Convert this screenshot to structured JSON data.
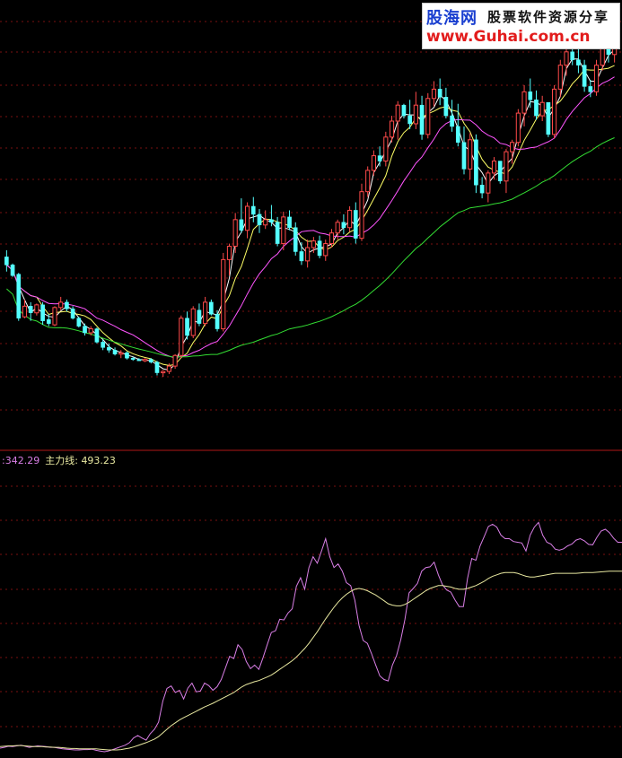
{
  "watermark": {
    "brand": "股海网",
    "slogan": "股票软件资源分享",
    "url": "www.Guhai.com.cn"
  },
  "indicator_panel": {
    "prefix": ":",
    "value1": "342.29",
    "name2": "主力线:",
    "value2": "493.23"
  },
  "colors": {
    "background": "#000000",
    "grid": "#7a1010",
    "separator": "#b01818",
    "up_candle": "#ff4a4a",
    "down_candle": "#54ffff",
    "ma_short": "#ffffff",
    "ma_mid": "#ffff66",
    "ma_long1": "#ff55ff",
    "ma_long2": "#33dd33",
    "ind_line1": "#d97fe6",
    "ind_line2": "#e8e8a0"
  },
  "chart_data": [
    {
      "type": "candlestick",
      "ylim": [
        0,
        100
      ],
      "ma_lines": [
        "white",
        "yellow",
        "magenta",
        "green"
      ],
      "candles": [
        [
          92,
          97,
          81,
          86
        ],
        [
          86,
          87,
          77,
          78
        ],
        [
          79,
          80,
          44,
          46
        ],
        [
          47,
          60,
          46,
          55
        ],
        [
          55,
          58,
          44,
          50
        ],
        [
          50,
          57,
          48,
          56
        ],
        [
          56,
          58,
          41,
          44
        ],
        [
          45,
          49,
          40,
          42
        ],
        [
          41,
          55,
          40,
          54
        ],
        [
          54,
          62,
          52,
          58
        ],
        [
          58,
          60,
          51,
          53
        ],
        [
          53,
          55,
          45,
          46
        ],
        [
          46,
          47,
          39,
          40
        ],
        [
          40,
          42,
          33,
          35
        ],
        [
          35,
          40,
          33,
          38
        ],
        [
          38,
          39,
          27,
          28
        ],
        [
          28,
          30,
          22,
          24
        ],
        [
          24,
          27,
          20,
          22
        ],
        [
          22,
          24,
          18,
          19
        ],
        [
          19,
          22,
          16,
          20
        ],
        [
          20,
          21,
          15,
          16
        ],
        [
          16,
          17,
          14,
          15
        ],
        [
          15,
          16,
          14,
          14
        ],
        [
          14,
          16,
          13,
          15
        ],
        [
          15,
          16,
          12,
          13
        ],
        [
          13,
          14,
          3,
          5
        ],
        [
          5,
          7,
          2,
          6
        ],
        [
          6,
          12,
          4,
          10
        ],
        [
          10,
          19,
          8,
          18
        ],
        [
          18,
          48,
          16,
          46
        ],
        [
          46,
          51,
          30,
          33
        ],
        [
          33,
          55,
          31,
          53
        ],
        [
          52,
          57,
          40,
          42
        ],
        [
          42,
          62,
          40,
          58
        ],
        [
          58,
          60,
          48,
          49
        ],
        [
          49,
          52,
          36,
          38
        ],
        [
          38,
          95,
          36,
          90
        ],
        [
          90,
          102,
          78,
          100
        ],
        [
          100,
          125,
          95,
          120
        ],
        [
          120,
          136,
          110,
          112
        ],
        [
          112,
          133,
          106,
          130
        ],
        [
          130,
          137,
          118,
          124
        ],
        [
          124,
          128,
          110,
          116
        ],
        [
          116,
          127,
          113,
          120
        ],
        [
          120,
          131,
          115,
          118
        ],
        [
          118,
          122,
          100,
          102
        ],
        [
          102,
          126,
          97,
          122
        ],
        [
          122,
          127,
          112,
          114
        ],
        [
          114,
          118,
          93,
          96
        ],
        [
          96,
          103,
          86,
          89
        ],
        [
          89,
          105,
          84,
          99
        ],
        [
          99,
          107,
          95,
          104
        ],
        [
          104,
          108,
          91,
          93
        ],
        [
          93,
          105,
          89,
          102
        ],
        [
          102,
          113,
          99,
          110
        ],
        [
          110,
          120,
          105,
          118
        ],
        [
          118,
          124,
          109,
          114
        ],
        [
          114,
          130,
          111,
          127
        ],
        [
          127,
          133,
          102,
          106
        ],
        [
          106,
          147,
          104,
          141
        ],
        [
          141,
          160,
          137,
          157
        ],
        [
          157,
          172,
          153,
          168
        ],
        [
          168,
          175,
          160,
          164
        ],
        [
          164,
          186,
          160,
          182
        ],
        [
          182,
          198,
          178,
          194
        ],
        [
          194,
          209,
          180,
          206
        ],
        [
          206,
          207,
          196,
          198
        ],
        [
          198,
          210,
          188,
          192
        ],
        [
          192,
          216,
          188,
          206
        ],
        [
          206,
          213,
          180,
          184
        ],
        [
          184,
          215,
          181,
          211
        ],
        [
          211,
          224,
          205,
          218
        ],
        [
          218,
          226,
          206,
          212
        ],
        [
          212,
          219,
          196,
          198
        ],
        [
          198,
          210,
          186,
          190
        ],
        [
          190,
          207,
          175,
          178
        ],
        [
          178,
          190,
          154,
          158
        ],
        [
          158,
          185,
          150,
          180
        ],
        [
          180,
          184,
          140,
          146
        ],
        [
          146,
          152,
          136,
          140
        ],
        [
          140,
          157,
          133,
          155
        ],
        [
          155,
          167,
          150,
          164
        ],
        [
          164,
          162,
          147,
          149
        ],
        [
          149,
          173,
          140,
          171
        ],
        [
          171,
          180,
          162,
          178
        ],
        [
          178,
          203,
          175,
          200
        ],
        [
          200,
          221,
          190,
          216
        ],
        [
          216,
          226,
          204,
          210
        ],
        [
          210,
          217,
          195,
          198
        ],
        [
          198,
          213,
          194,
          208
        ],
        [
          208,
          203,
          182,
          184
        ],
        [
          184,
          221,
          181,
          218
        ],
        [
          218,
          240,
          212,
          236
        ],
        [
          236,
          253,
          228,
          246
        ],
        [
          246,
          254,
          236,
          240
        ],
        [
          240,
          252,
          230,
          236
        ],
        [
          236,
          240,
          216,
          220
        ],
        [
          220,
          225,
          212,
          216
        ],
        [
          216,
          240,
          213,
          236
        ],
        [
          236,
          254,
          232,
          250
        ],
        [
          250,
          258,
          238,
          244
        ],
        [
          244,
          252,
          238,
          249
        ]
      ]
    },
    {
      "type": "line",
      "name": "主力线",
      "ylim": [
        0,
        800
      ],
      "series": [
        {
          "values": [
            20,
            22,
            25,
            24,
            26,
            28,
            25,
            22,
            24,
            26,
            25,
            24,
            22,
            22,
            20,
            18,
            17,
            16,
            15,
            15,
            16,
            16,
            17,
            14,
            12,
            10,
            12,
            16,
            20,
            24,
            28,
            35,
            48,
            55,
            48,
            42,
            60,
            72,
            92,
            150,
            185,
            192,
            174,
            180,
            156,
            186,
            200,
            176,
            178,
            200,
            193,
            180,
            190,
            210,
            242,
            274,
            268,
            306,
            293,
            260,
            240,
            250,
            238,
            270,
            306,
            340,
            345,
            377,
            375,
            394,
            406,
            468,
            492,
            460,
            520,
            550,
            532,
            565,
            600,
            550,
            520,
            530,
            510,
            478,
            470,
            430,
            360,
            318,
            310,
            282,
            250,
            220,
            210,
            206,
            250,
            276,
            320,
            376,
            450,
            462,
            476,
            510,
            520,
            522,
            535,
            500,
            472,
            458,
            452,
            430,
            412,
            412,
            490,
            545,
            540,
            580,
            606,
            634,
            640,
            632,
            610,
            600,
            600,
            592,
            590,
            588,
            566,
            610,
            632,
            645,
            610,
            590,
            585,
            571,
            568,
            572,
            580,
            585,
            596,
            600,
            594,
            584,
            583,
            604,
            621,
            626,
            617,
            601,
            590,
            590
          ]
        },
        {
          "values": [
            24,
            25,
            26,
            26,
            27,
            27,
            26,
            25,
            24,
            24,
            24,
            23,
            23,
            22,
            22,
            21,
            20,
            19,
            19,
            18,
            18,
            18,
            18,
            18,
            17,
            16,
            15,
            15,
            15,
            16,
            18,
            20,
            23,
            27,
            31,
            35,
            40,
            45,
            52,
            62,
            72,
            82,
            90,
            98,
            104,
            110,
            116,
            122,
            128,
            134,
            139,
            144,
            150,
            156,
            162,
            168,
            174,
            182,
            190,
            196,
            200,
            204,
            207,
            212,
            217,
            222,
            230,
            238,
            246,
            254,
            262,
            272,
            284,
            296,
            310,
            326,
            342,
            360,
            378,
            394,
            410,
            424,
            436,
            446,
            454,
            460,
            462,
            460,
            456,
            450,
            444,
            436,
            428,
            420,
            416,
            414,
            414,
            418,
            424,
            432,
            440,
            448,
            456,
            462,
            466,
            470,
            470,
            468,
            466,
            462,
            460,
            460,
            462,
            466,
            470,
            476,
            482,
            490,
            496,
            500,
            504,
            506,
            506,
            506,
            504,
            500,
            496,
            494,
            494,
            496,
            498,
            500,
            502,
            504,
            504,
            504,
            504,
            504,
            504,
            505,
            506,
            506,
            506,
            507,
            508,
            509,
            510,
            510,
            510,
            510
          ]
        }
      ]
    }
  ]
}
